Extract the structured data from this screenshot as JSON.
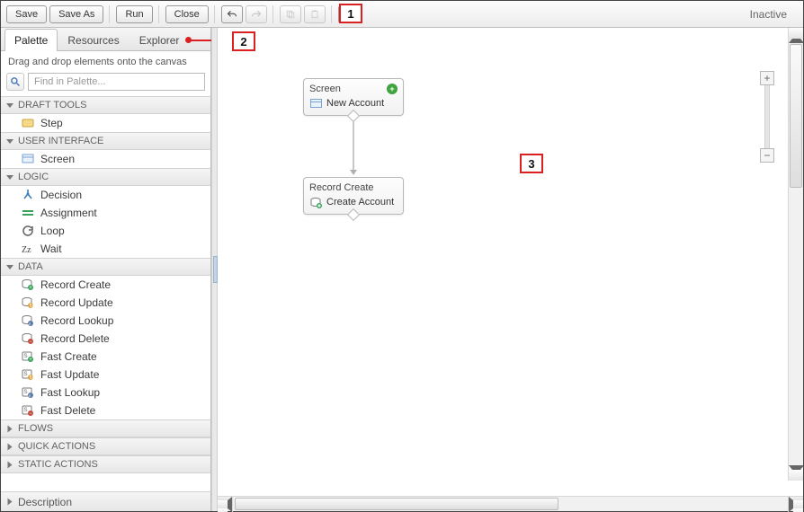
{
  "toolbar": {
    "save": "Save",
    "save_as": "Save As",
    "run": "Run",
    "close": "Close"
  },
  "status": "Inactive",
  "callouts": {
    "one": "1",
    "two": "2",
    "three": "3"
  },
  "sidebar": {
    "tabs": {
      "palette": "Palette",
      "resources": "Resources",
      "explorer": "Explorer"
    },
    "hint": "Drag and drop elements onto the canvas",
    "search_placeholder": "Find in Palette...",
    "sections": {
      "draft_tools": {
        "label": "DRAFT TOOLS",
        "items": [
          "Step"
        ]
      },
      "user_interface": {
        "label": "USER INTERFACE",
        "items": [
          "Screen"
        ]
      },
      "logic": {
        "label": "LOGIC",
        "items": [
          "Decision",
          "Assignment",
          "Loop",
          "Wait"
        ]
      },
      "data": {
        "label": "DATA",
        "items": [
          "Record Create",
          "Record Update",
          "Record Lookup",
          "Record Delete",
          "Fast Create",
          "Fast Update",
          "Fast Lookup",
          "Fast Delete"
        ]
      },
      "flows": {
        "label": "FLOWS"
      },
      "quick_actions": {
        "label": "QUICK ACTIONS"
      },
      "static_actions": {
        "label": "STATIC ACTIONS"
      }
    },
    "description": "Description"
  },
  "canvas": {
    "nodes": {
      "screen": {
        "title": "Screen",
        "sub": "New Account"
      },
      "record_create": {
        "title": "Record Create",
        "sub": "Create Account"
      }
    }
  }
}
